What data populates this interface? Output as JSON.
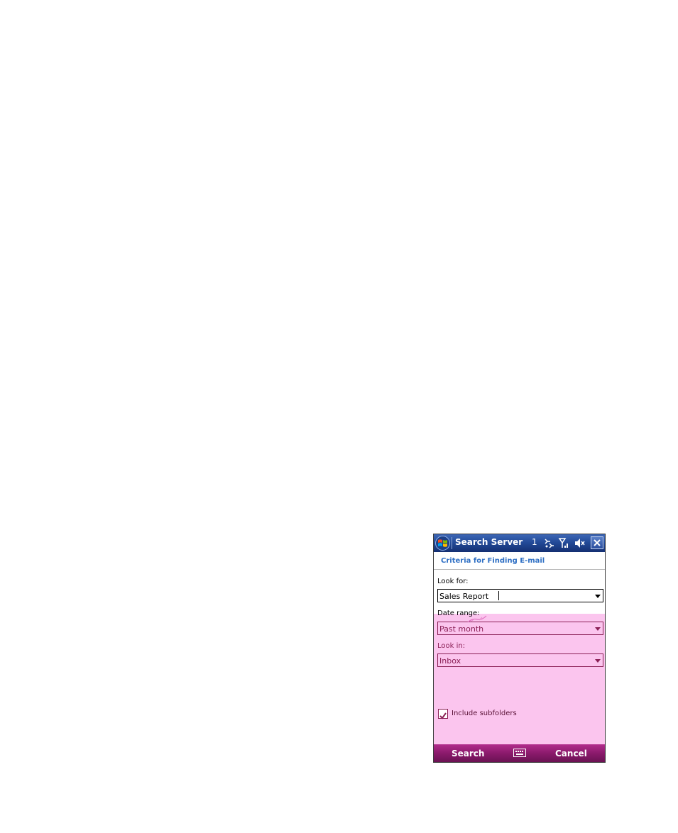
{
  "window": {
    "title": "Search Server",
    "notification_count": "1",
    "status_icons": [
      "connectivity-icon",
      "signal-icon",
      "speaker-muted-icon"
    ],
    "close_label": "X"
  },
  "header": {
    "title": "Criteria for Finding E-mail"
  },
  "form": {
    "look_for": {
      "label": "Look for:",
      "value": "Sales Report"
    },
    "date_range": {
      "label": "Date range:",
      "value": "Past month"
    },
    "look_in": {
      "label": "Look in:",
      "value": "Inbox"
    },
    "include_subfolders": {
      "label": "Include subfolders",
      "checked": true
    }
  },
  "softkeys": {
    "left": "Search",
    "right": "Cancel",
    "center_icon": "keyboard-icon"
  },
  "colors": {
    "titlebar": "#234a98",
    "header_text": "#2e6fc4",
    "highlight": "#fbc5ee",
    "highlight_text": "#8a1f55",
    "softbar": "#8b1a6c"
  }
}
